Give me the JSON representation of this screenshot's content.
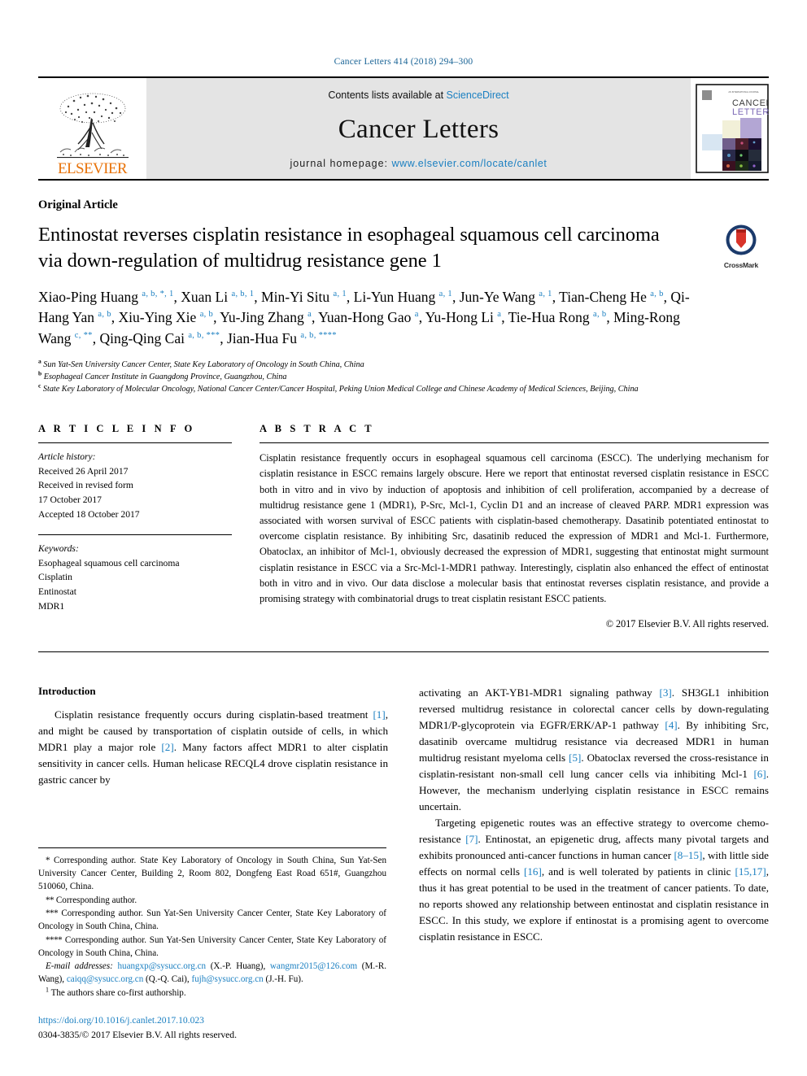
{
  "running_head": "Cancer Letters 414 (2018) 294–300",
  "masthead": {
    "publisher_name": "ELSEVIER",
    "contents_prefix": "Contents lists available at ",
    "contents_link": "ScienceDirect",
    "journal_title": "Cancer Letters",
    "homepage_prefix": "journal homepage: ",
    "homepage_url": "www.elsevier.com/locate/canlet",
    "cover_title_line1": "CANCER",
    "cover_title_line2": "LETTERS"
  },
  "article": {
    "type": "Original Article",
    "title": "Entinostat reverses cisplatin resistance in esophageal squamous cell carcinoma via down-regulation of multidrug resistance gene 1",
    "crossmark_label": "CrossMark",
    "authors_html": "Xiao-Ping Huang <sup>a, b, *, 1</sup>, Xuan Li <sup>a, b, 1</sup>, Min-Yi Situ <sup>a, 1</sup>, Li-Yun Huang <sup>a, 1</sup>, Jun-Ye Wang <sup>a, 1</sup>, Tian-Cheng He <sup>a, b</sup>, Qi-Hang Yan <sup>a, b</sup>, Xiu-Ying Xie <sup>a, b</sup>, Yu-Jing Zhang <sup>a</sup>, Yuan-Hong Gao <sup>a</sup>, Yu-Hong Li <sup>a</sup>, Tie-Hua Rong <sup>a, b</sup>, Ming-Rong Wang <sup>c, **</sup>, Qing-Qing Cai <sup>a, b, ***</sup>, Jian-Hua Fu <sup>a, b, ****</sup>",
    "affiliations": [
      {
        "mark": "a",
        "text": "Sun Yat-Sen University Cancer Center, State Key Laboratory of Oncology in South China, China"
      },
      {
        "mark": "b",
        "text": "Esophageal Cancer Institute in Guangdong Province, Guangzhou, China"
      },
      {
        "mark": "c",
        "text": "State Key Laboratory of Molecular Oncology, National Cancer Center/Cancer Hospital, Peking Union Medical College and Chinese Academy of Medical Sciences, Beijing, China"
      }
    ]
  },
  "article_info": {
    "heading": "A R T I C L E  I N F O",
    "history_label": "Article history:",
    "history": [
      "Received 26 April 2017",
      "Received in revised form",
      "17 October 2017",
      "Accepted 18 October 2017"
    ],
    "keywords_label": "Keywords:",
    "keywords": [
      "Esophageal squamous cell carcinoma",
      "Cisplatin",
      "Entinostat",
      "MDR1"
    ]
  },
  "abstract": {
    "heading": "A B S T R A C T",
    "text": "Cisplatin resistance frequently occurs in esophageal squamous cell carcinoma (ESCC). The underlying mechanism for cisplatin resistance in ESCC remains largely obscure. Here we report that entinostat reversed cisplatin resistance in ESCC both in vitro and in vivo by induction of apoptosis and inhibition of cell proliferation, accompanied by a decrease of multidrug resistance gene 1 (MDR1), P-Src, Mcl-1, Cyclin D1 and an increase of cleaved PARP. MDR1 expression was associated with worsen survival of ESCC patients with cisplatin-based chemotherapy. Dasatinib potentiated entinostat to overcome cisplatin resistance. By inhibiting Src, dasatinib reduced the expression of MDR1 and Mcl-1. Furthermore, Obatoclax, an inhibitor of Mcl-1, obviously decreased the expression of MDR1, suggesting that entinostat might surmount cisplatin resistance in ESCC via a Src-Mcl-1-MDR1 pathway. Interestingly, cisplatin also enhanced the effect of entinostat both in vitro and in vivo. Our data disclose a molecular basis that entinostat reverses cisplatin resistance, and provide a promising strategy with combinatorial drugs to treat cisplatin resistant ESCC patients.",
    "copyright": "© 2017 Elsevier B.V. All rights reserved."
  },
  "introduction": {
    "heading": "Introduction",
    "left_paragraph_parts": [
      "Cisplatin resistance frequently occurs during cisplatin-based treatment ",
      "[1]",
      ", and might be caused by transportation of cisplatin outside of cells, in which MDR1 play a major role ",
      "[2]",
      ". Many factors affect MDR1 to alter cisplatin sensitivity in cancer cells. Human helicase RECQL4 drove cisplatin resistance in gastric cancer by"
    ],
    "right_paragraph1_parts": [
      "activating an AKT-YB1-MDR1 signaling pathway ",
      "[3]",
      ". SH3GL1 inhibition reversed multidrug resistance in colorectal cancer cells by down-regulating MDR1/P-glycoprotein via EGFR/ERK/AP-1 pathway ",
      "[4]",
      ". By inhibiting Src, dasatinib overcame multidrug resistance via decreased MDR1 in human multidrug resistant myeloma cells ",
      "[5]",
      ". Obatoclax reversed the cross-resistance in cisplatin-resistant non-small cell lung cancer cells via inhibiting Mcl-1 ",
      "[6]",
      ". However, the mechanism underlying cisplatin resistance in ESCC remains uncertain."
    ],
    "right_paragraph2_parts": [
      "Targeting epigenetic routes was an effective strategy to overcome chemo-resistance ",
      "[7]",
      ". Entinostat, an epigenetic drug, affects many pivotal targets and exhibits pronounced anti-cancer functions in human cancer ",
      "[8–15]",
      ", with little side effects on normal cells ",
      "[16]",
      ", and is well tolerated by patients in clinic ",
      "[15,17]",
      ", thus it has great potential to be used in the treatment of cancer patients. To date, no reports showed any relationship between entinostat and cisplatin resistance in ESCC. In this study, we explore if entinostat is a promising agent to overcome cisplatin resistance in ESCC."
    ]
  },
  "footnotes": [
    {
      "mark": "*",
      "text": "Corresponding author. State Key Laboratory of Oncology in South China, Sun Yat-Sen University Cancer Center, Building 2, Room 802, Dongfeng East Road 651#, Guangzhou 510060, China."
    },
    {
      "mark": "**",
      "text": "Corresponding author."
    },
    {
      "mark": "***",
      "text": "Corresponding author. Sun Yat-Sen University Cancer Center, State Key Laboratory of Oncology in South China, China."
    },
    {
      "mark": "****",
      "text": "Corresponding author. Sun Yat-Sen University Cancer Center, State Key Laboratory of Oncology in South China, China."
    }
  ],
  "emails": {
    "label": "E-mail addresses:",
    "entries": [
      {
        "address": "huangxp@sysucc.org.cn",
        "name": "(X.-P. Huang)"
      },
      {
        "address": "wangmr2015@126.com",
        "name": "(M.-R. Wang)"
      },
      {
        "address": "caiqq@sysucc.org.cn",
        "name": "(Q.-Q. Cai)"
      },
      {
        "address": "fujh@sysucc.org.cn",
        "name": "(J.-H. Fu)"
      }
    ]
  },
  "cofirst_note": {
    "mark": "1",
    "text": "The authors share co-first authorship."
  },
  "doi": "https://doi.org/10.1016/j.canlet.2017.10.023",
  "issn_line": "0304-3835/© 2017 Elsevier B.V. All rights reserved.",
  "colors": {
    "link": "#1a7fc1",
    "elsevier_orange": "#E8730A",
    "masthead_bg": "#e4e4e4"
  }
}
